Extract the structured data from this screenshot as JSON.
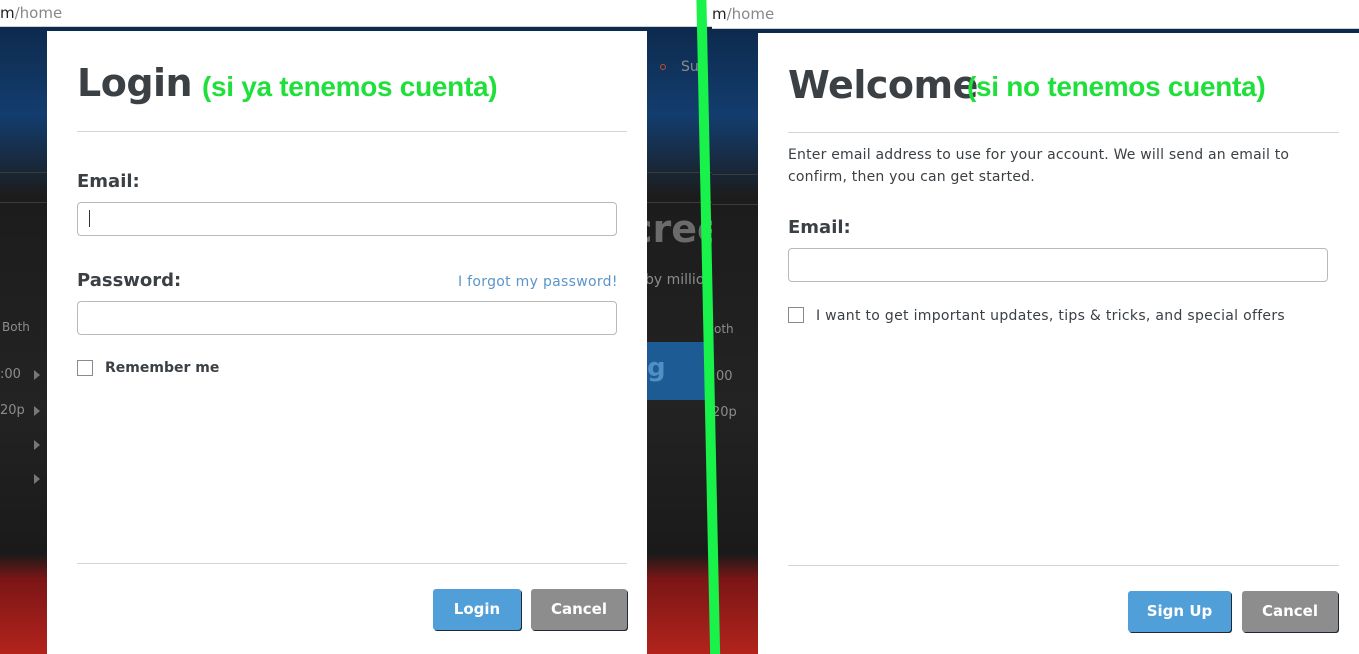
{
  "left": {
    "url": {
      "host_tail": "m",
      "path": "/home"
    },
    "background": {
      "nav_item": "Sup",
      "hero_fragment": "cree",
      "sub_fragment": "by millio",
      "button_fragment": "g",
      "labels": [
        "Both",
        ":00",
        "20p"
      ]
    },
    "login": {
      "title": "Login",
      "annotation": "(si ya tenemos cuenta)",
      "email_label": "Email:",
      "email_value": "",
      "password_label": "Password:",
      "password_value": "",
      "forgot_link": "I forgot my password!",
      "remember_label": "Remember me",
      "remember_checked": false,
      "login_button": "Login",
      "cancel_button": "Cancel"
    }
  },
  "right": {
    "url": {
      "host_tail": "m",
      "path": "/home"
    },
    "background": {
      "labels": [
        "oth",
        "00",
        "20p"
      ]
    },
    "signup": {
      "title": "Welcome",
      "annotation": "(si no tenemos cuenta)",
      "description": "Enter email address to use for your account. We will send an email to confirm, then you can get started.",
      "email_label": "Email:",
      "email_value": "",
      "updates_label": "I want to get important updates, tips & tricks, and special offers",
      "updates_checked": false,
      "signup_button": "Sign Up",
      "cancel_button": "Cancel"
    }
  },
  "colors": {
    "primary_button": "#519fd8",
    "secondary_button": "#8d8d8d",
    "annotation_green": "#1fe03a",
    "separator_green": "#18f24a",
    "link_blue": "#5b95c9"
  }
}
